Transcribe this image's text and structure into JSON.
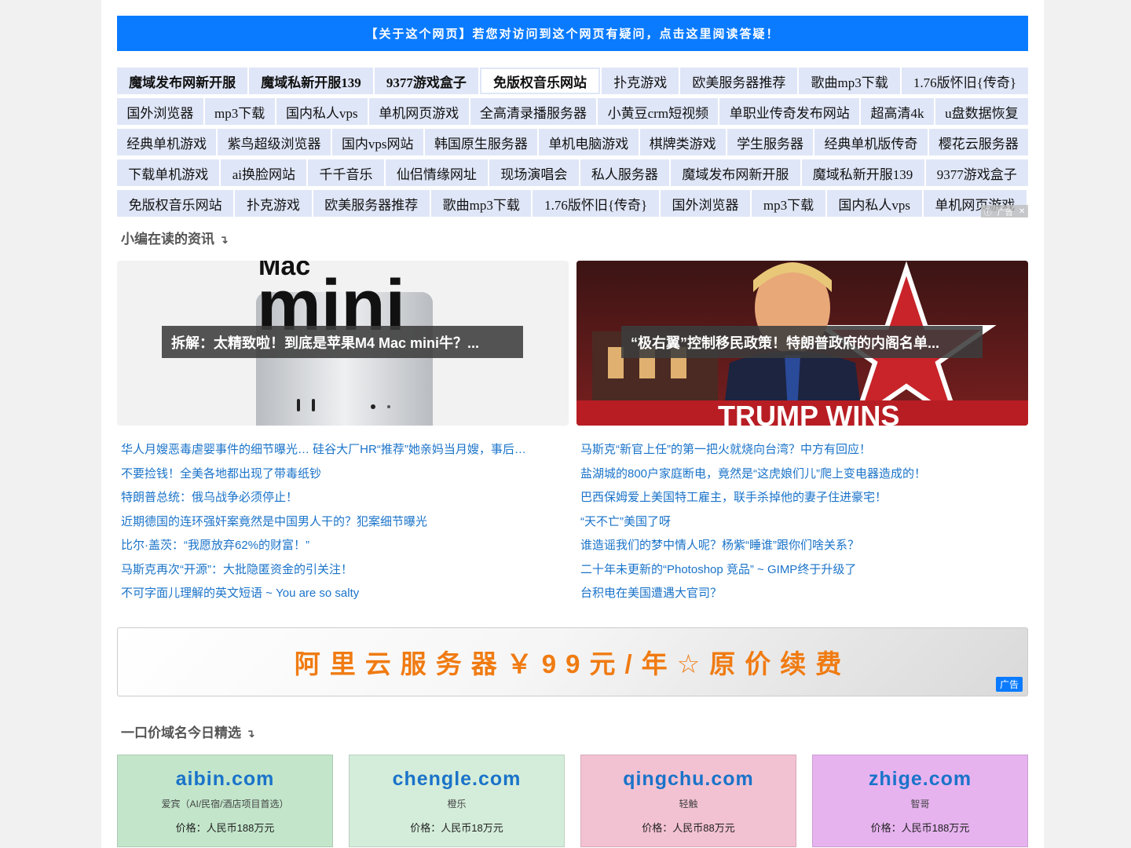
{
  "notice": "【关于这个网页】若您对访问到这个网页有疑问，点击这里阅读答疑！",
  "link_rows": [
    [
      "魔域发布网新开服",
      "魔域私新开服139",
      "9377游戏盒子",
      "免版权音乐网站",
      "扑克游戏",
      "欧美服务器推荐",
      "歌曲mp3下载",
      "1.76版怀旧{传奇}"
    ],
    [
      "国外浏览器",
      "mp3下载",
      "国内私人vps",
      "单机网页游戏",
      "全高清录播服务器",
      "小黄豆crm短视频",
      "单职业传奇发布网站",
      "超高清4k",
      "u盘数据恢复"
    ],
    [
      "经典单机游戏",
      "紫鸟超级浏览器",
      "国内vps网站",
      "韩国原生服务器",
      "单机电脑游戏",
      "棋牌类游戏",
      "学生服务器",
      "经典单机版传奇",
      "樱花云服务器"
    ],
    [
      "下载单机游戏",
      "ai换脸网站",
      "千千音乐",
      "仙侣情缘网址",
      "现场演唱会",
      "私人服务器",
      "魔域发布网新开服",
      "魔域私新开服139",
      "9377游戏盒子"
    ],
    [
      "免版权音乐网站",
      "扑克游戏",
      "欧美服务器推荐",
      "歌曲mp3下载",
      "1.76版怀旧{传奇}",
      "国外浏览器",
      "mp3下载",
      "国内私人vps",
      "单机网页游戏"
    ]
  ],
  "ad_mini": {
    "info": "ⓘ",
    "label": "广告",
    "close": "✕"
  },
  "section_news": {
    "title": "小编在读的资讯",
    "arrow": "↴"
  },
  "featured": [
    {
      "caption": "拆解：太精致啦！到底是苹果M4 Mac mini牛？...",
      "img_text_small": "Mac",
      "img_text_big": "mini"
    },
    {
      "caption": "“极右翼”控制移民政策！特朗普政府的内阁名单...",
      "img_text_banner": "TRUMP WINS"
    }
  ],
  "news_left": [
    "华人月嫂恶毒虐婴事件的细节曝光… 硅谷大厂HR“推荐”她亲妈当月嫂，事后…",
    "不要捡钱！全美各地都出现了带毒纸钞",
    "特朗普总统：俄乌战争必须停止！",
    "近期德国的连环强奸案竟然是中国男人干的？犯案细节曝光",
    "比尔·盖茨：“我愿放弃62%的财富！”",
    "马斯克再次“开源”：大批隐匿资金的引关注！",
    "不可字面儿理解的英文短语 ~ You are so salty"
  ],
  "news_right": [
    "马斯克“新官上任”的第一把火就烧向台湾？中方有回应！",
    "盐湖城的800户家庭断电，竟然是“这虎娘们儿”爬上变电器造成的！",
    "巴西保姆爱上美国特工雇主，联手杀掉他的妻子住进豪宅！",
    "“天不亡”美国了呀",
    "谁造谣我们的梦中情人呢？杨紫“睡谁”跟你们啥关系？",
    "二十年未更新的“Photoshop 竞品” ~ GIMP终于升级了",
    "台积电在美国遭遇大官司？"
  ],
  "banner": {
    "text": "阿里云服务器￥99元/年☆原价续费",
    "ad_label": "广告"
  },
  "section_domains": {
    "title": "一口价域名今日精选",
    "arrow": "↴"
  },
  "domains": [
    {
      "name": "aibin.com",
      "desc": "爱宾（AI/民宿/酒店项目首选）",
      "price": "价格：人民币188万元",
      "color": "#c3e6cb"
    },
    {
      "name": "chengle.com",
      "desc": "橙乐",
      "price": "价格：人民币18万元",
      "color": "#d4edda"
    },
    {
      "name": "qingchu.com",
      "desc": "轻触",
      "price": "价格：人民币88万元",
      "color": "#f3c2d2"
    },
    {
      "name": "zhige.com",
      "desc": "智哥",
      "price": "价格：人民币188万元",
      "color": "#e6b3ef"
    }
  ]
}
